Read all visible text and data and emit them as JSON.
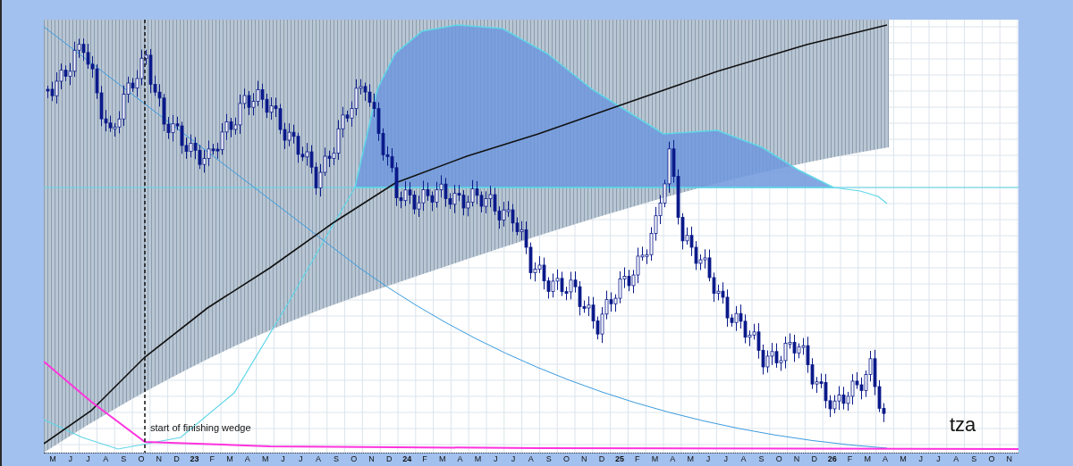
{
  "chart": {
    "annotation": "start of finishing wedge",
    "symbol": "tza",
    "x_axis_labels": [
      {
        "label": "M",
        "kind": "month"
      },
      {
        "label": "J",
        "kind": "month"
      },
      {
        "label": "J",
        "kind": "month"
      },
      {
        "label": "A",
        "kind": "month"
      },
      {
        "label": "S",
        "kind": "month"
      },
      {
        "label": "O",
        "kind": "month"
      },
      {
        "label": "N",
        "kind": "month"
      },
      {
        "label": "D",
        "kind": "month"
      },
      {
        "label": "23",
        "kind": "year"
      },
      {
        "label": "F",
        "kind": "month"
      },
      {
        "label": "M",
        "kind": "month"
      },
      {
        "label": "A",
        "kind": "month"
      },
      {
        "label": "M",
        "kind": "month"
      },
      {
        "label": "J",
        "kind": "month"
      },
      {
        "label": "J",
        "kind": "month"
      },
      {
        "label": "A",
        "kind": "month"
      },
      {
        "label": "S",
        "kind": "month"
      },
      {
        "label": "O",
        "kind": "month"
      },
      {
        "label": "N",
        "kind": "month"
      },
      {
        "label": "D",
        "kind": "month"
      },
      {
        "label": "24",
        "kind": "year"
      },
      {
        "label": "F",
        "kind": "month"
      },
      {
        "label": "M",
        "kind": "month"
      },
      {
        "label": "A",
        "kind": "month"
      },
      {
        "label": "M",
        "kind": "month"
      },
      {
        "label": "J",
        "kind": "month"
      },
      {
        "label": "J",
        "kind": "month"
      },
      {
        "label": "A",
        "kind": "month"
      },
      {
        "label": "S",
        "kind": "month"
      },
      {
        "label": "O",
        "kind": "month"
      },
      {
        "label": "N",
        "kind": "month"
      },
      {
        "label": "D",
        "kind": "month"
      },
      {
        "label": "25",
        "kind": "year"
      },
      {
        "label": "F",
        "kind": "month"
      },
      {
        "label": "M",
        "kind": "month"
      },
      {
        "label": "A",
        "kind": "month"
      },
      {
        "label": "M",
        "kind": "month"
      },
      {
        "label": "J",
        "kind": "month"
      },
      {
        "label": "J",
        "kind": "month"
      },
      {
        "label": "A",
        "kind": "month"
      },
      {
        "label": "S",
        "kind": "month"
      },
      {
        "label": "O",
        "kind": "month"
      },
      {
        "label": "N",
        "kind": "month"
      },
      {
        "label": "D",
        "kind": "month"
      },
      {
        "label": "26",
        "kind": "year"
      },
      {
        "label": "F",
        "kind": "month"
      },
      {
        "label": "M",
        "kind": "month"
      },
      {
        "label": "A",
        "kind": "month"
      },
      {
        "label": "M",
        "kind": "month"
      },
      {
        "label": "J",
        "kind": "month"
      },
      {
        "label": "J",
        "kind": "month"
      },
      {
        "label": "A",
        "kind": "month"
      },
      {
        "label": "S",
        "kind": "month"
      },
      {
        "label": "O",
        "kind": "month"
      },
      {
        "label": "N",
        "kind": "month"
      }
    ]
  }
}
